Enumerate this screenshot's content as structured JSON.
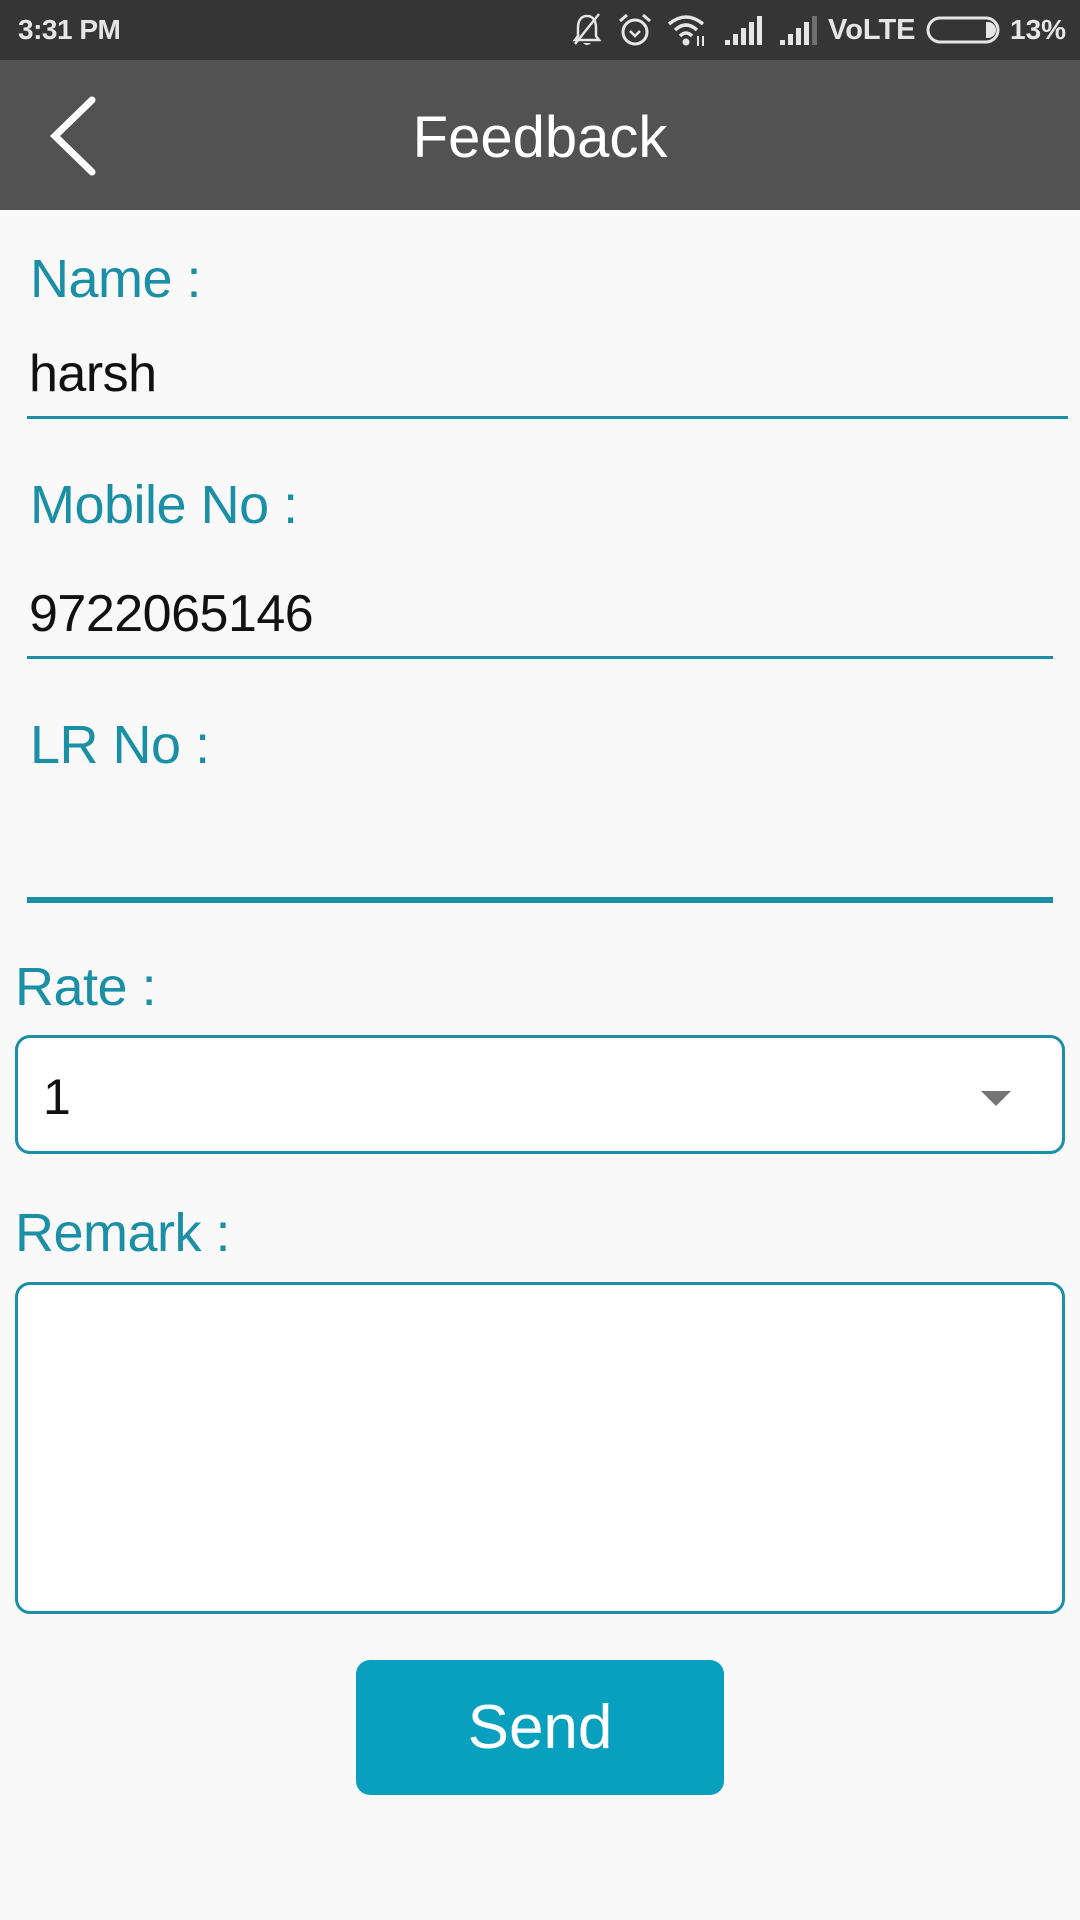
{
  "status_bar": {
    "time": "3:31 PM",
    "icons": [
      "bell-off-icon",
      "alarm-icon",
      "wifi-icon",
      "signal-icon",
      "signal-icon"
    ],
    "network": "VoLTE",
    "battery_percent": "13%",
    "battery_level": 0.13
  },
  "app_bar": {
    "back_icon": "chevron-left-icon",
    "title": "Feedback"
  },
  "form": {
    "name": {
      "label": "Name :",
      "value": "harsh"
    },
    "mobile": {
      "label": "Mobile No :",
      "value": "9722065146"
    },
    "lr_no": {
      "label": "LR No :",
      "value": ""
    },
    "rate": {
      "label": "Rate :",
      "selected": "1",
      "icon": "dropdown-arrow-icon"
    },
    "remark": {
      "label": "Remark :",
      "value": ""
    },
    "send_label": "Send"
  },
  "colors": {
    "accent": "#1a8fa6",
    "button": "#09a0bf",
    "app_bar": "#525252",
    "status_bar": "#353535",
    "background": "#f9f9f9"
  }
}
